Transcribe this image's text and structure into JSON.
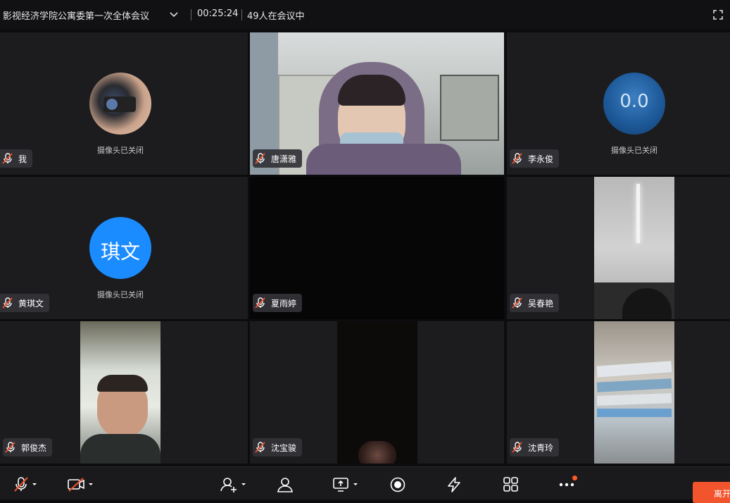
{
  "meeting": {
    "title": "影视经济学院公寓委第一次全体会议",
    "timer": "00:25:24",
    "participants_status": "49人在会议中"
  },
  "camera_off_label": "摄像头已关闭",
  "tiles": [
    {
      "name": "我",
      "state": "camera-off-photo"
    },
    {
      "name": "唐潇雅",
      "state": "video"
    },
    {
      "name": "李永俊",
      "state": "camera-off-photo",
      "avatar_text": "0.0"
    },
    {
      "name": "黄琪文",
      "state": "camera-off-initials",
      "avatar_text": "琪文",
      "avatar_color": "#1a8cff"
    },
    {
      "name": "夏雨婷",
      "state": "video"
    },
    {
      "name": "吴春艳",
      "state": "video"
    },
    {
      "name": "郭俊杰",
      "state": "video"
    },
    {
      "name": "沈宝骏",
      "state": "video"
    },
    {
      "name": "沈青玲",
      "state": "video"
    }
  ],
  "toolbar": {
    "leave_label": "离开",
    "accent": "#f2542d"
  }
}
